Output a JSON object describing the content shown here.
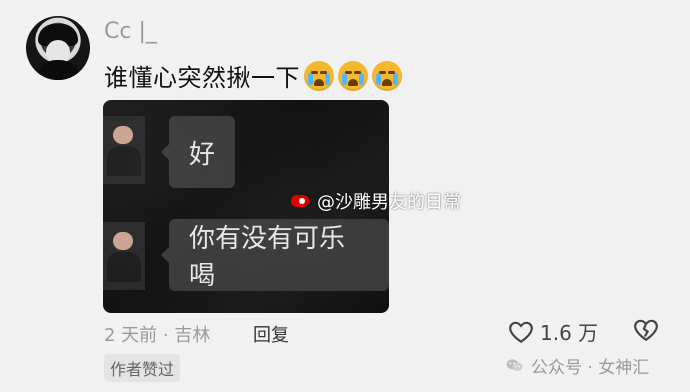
{
  "user": {
    "name": "Cc |_",
    "comment": "谁懂心突然揪一下",
    "emojis": [
      "crying-face-icon",
      "crying-face-icon",
      "crying-face-icon"
    ]
  },
  "chat_image": {
    "bubble_1": "好",
    "bubble_2": "你有没有可乐喝",
    "watermark": "@沙雕男友的日常"
  },
  "meta": {
    "time_location": "2 天前 · 吉林",
    "reply_label": "回复",
    "like_count": "1.6 万",
    "author_liked": "作者赞过",
    "public_tag": "公众号 · 女神汇"
  },
  "icons": {
    "heart": "heart-icon",
    "broken_heart": "broken-heart-icon",
    "wechat": "wechat-icon",
    "weibo": "weibo-icon"
  }
}
